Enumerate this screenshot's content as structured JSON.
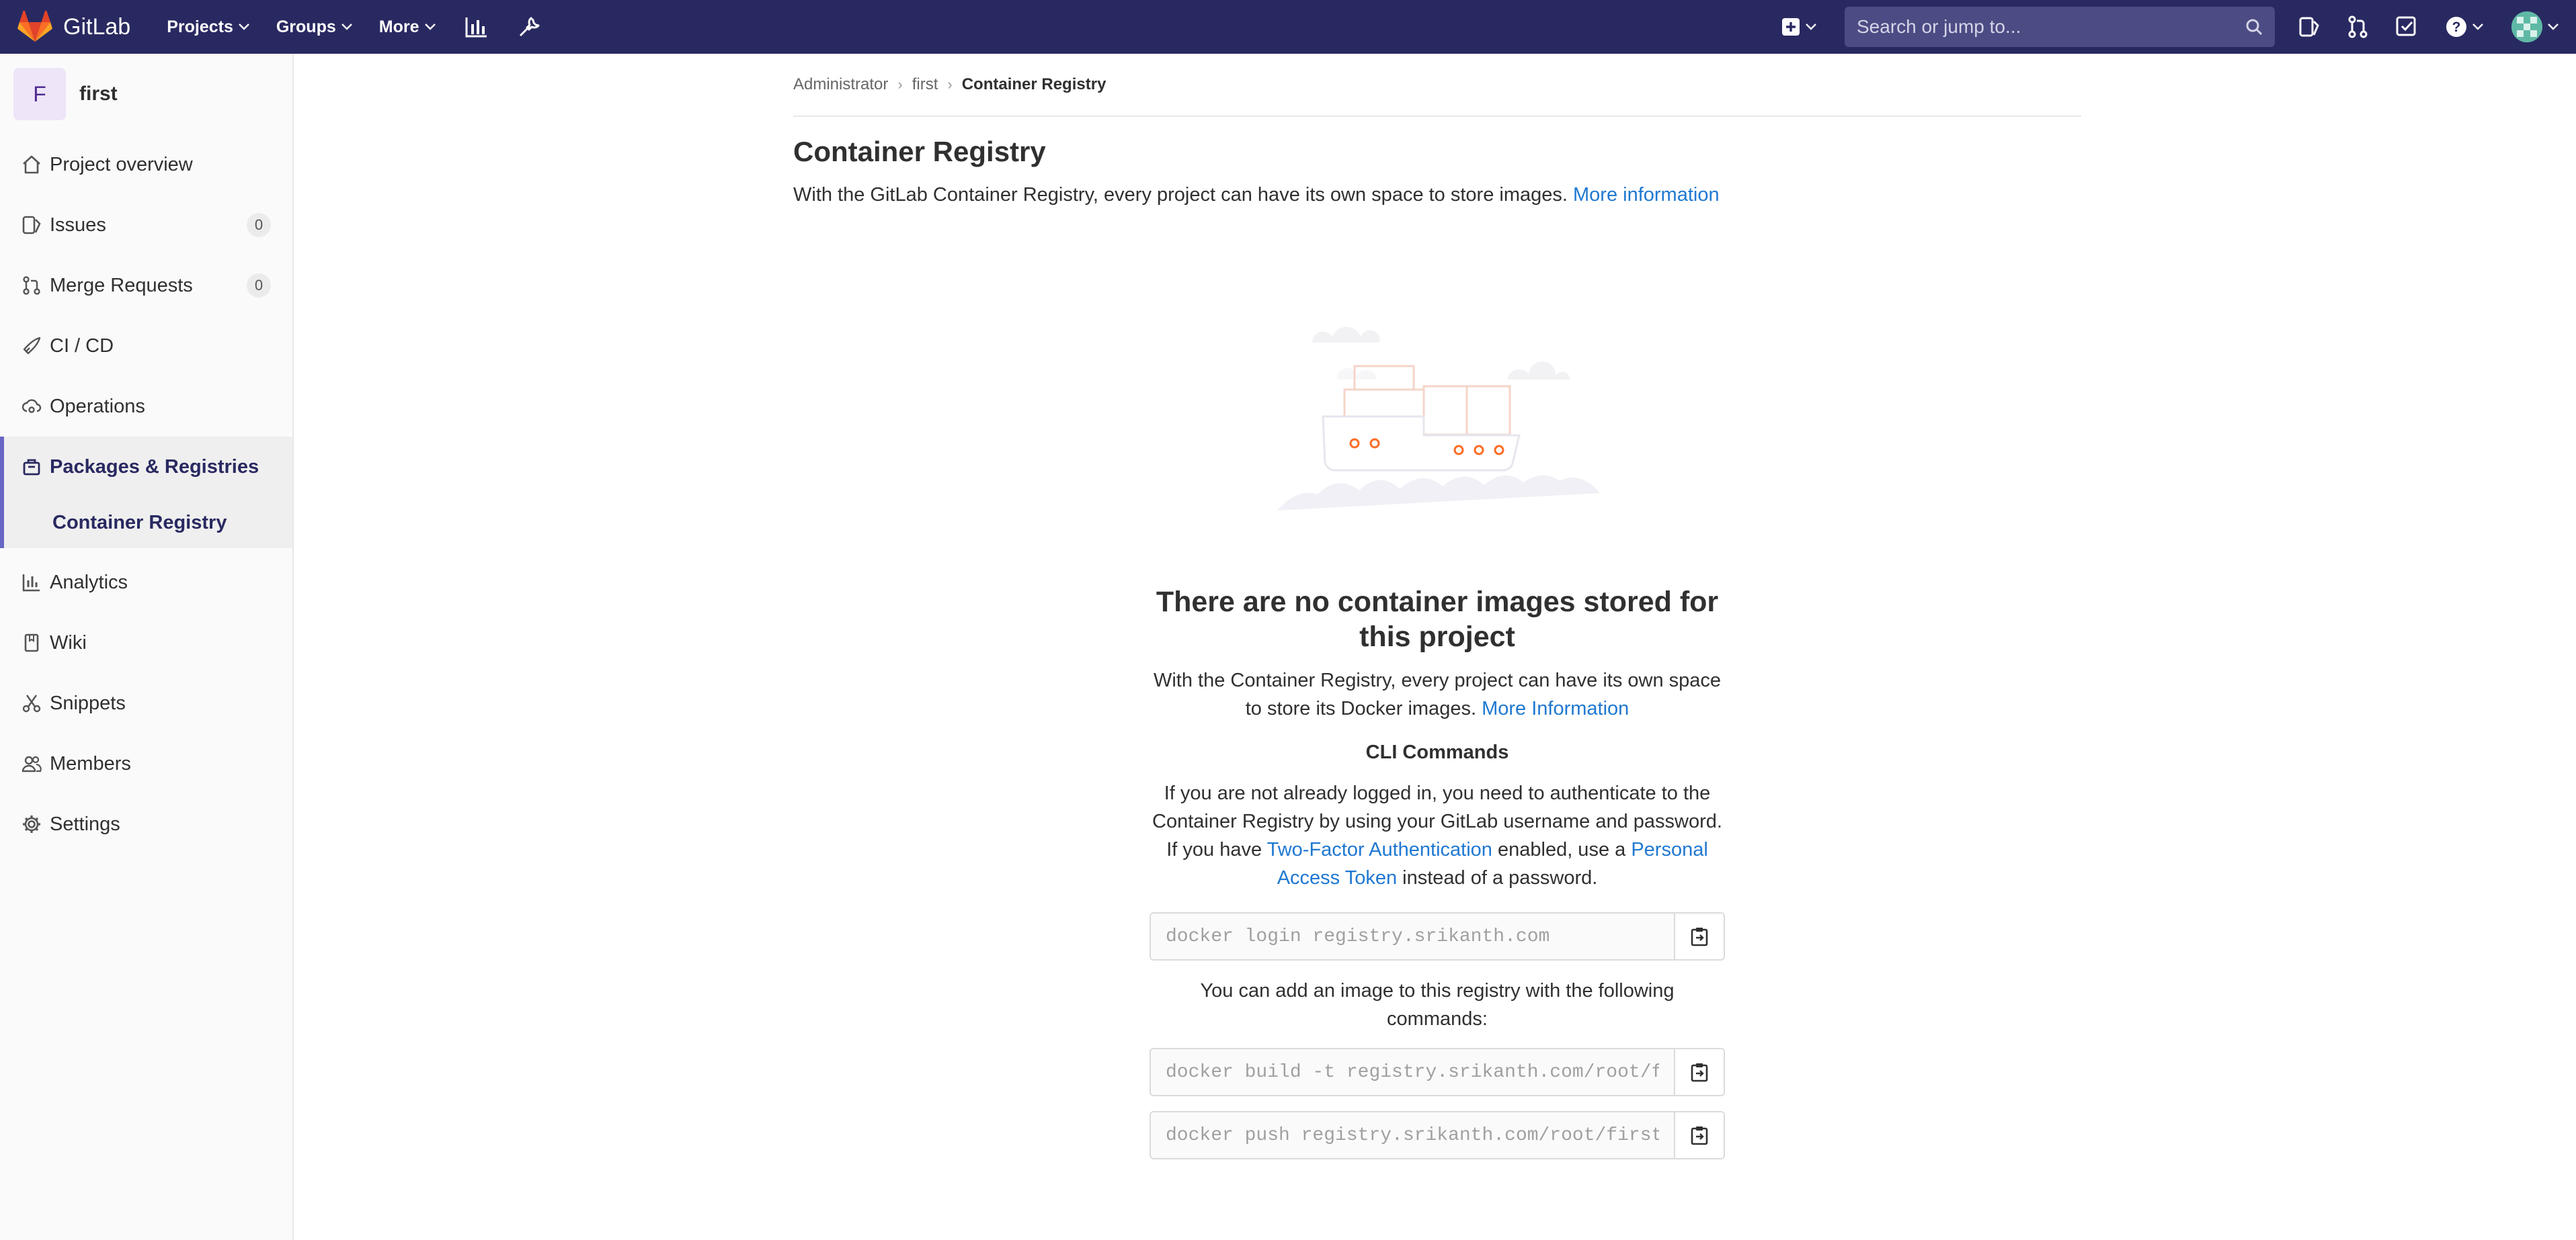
{
  "navbar": {
    "brand": "GitLab",
    "projects": "Projects",
    "groups": "Groups",
    "more": "More",
    "search_placeholder": "Search or jump to..."
  },
  "sidebar": {
    "project_initial": "F",
    "project_name": "first",
    "items": [
      {
        "label": "Project overview",
        "icon": "home-icon"
      },
      {
        "label": "Issues",
        "icon": "issues-icon",
        "count": "0"
      },
      {
        "label": "Merge Requests",
        "icon": "merge-request-icon",
        "count": "0"
      },
      {
        "label": "CI / CD",
        "icon": "rocket-icon"
      },
      {
        "label": "Operations",
        "icon": "cloud-gear-icon"
      },
      {
        "label": "Packages & Registries",
        "icon": "package-icon"
      },
      {
        "label": "Analytics",
        "icon": "chart-icon"
      },
      {
        "label": "Wiki",
        "icon": "book-icon"
      },
      {
        "label": "Snippets",
        "icon": "scissors-icon"
      },
      {
        "label": "Members",
        "icon": "users-icon"
      },
      {
        "label": "Settings",
        "icon": "gear-icon"
      }
    ],
    "subitem": "Container Registry"
  },
  "breadcrumb": {
    "items": [
      "Administrator",
      "first",
      "Container Registry"
    ]
  },
  "page": {
    "title": "Container Registry",
    "lead": "With the GitLab Container Registry, every project can have its own space to store images.",
    "lead_link": "More information"
  },
  "empty_state": {
    "title": "There are no container images stored for this project",
    "desc": "With the Container Registry, every project can have its own space to store its Docker images.",
    "desc_link": "More Information",
    "cli_heading": "CLI Commands",
    "cli_text_1": "If you are not already logged in, you need to authenticate to the Container Registry by using your GitLab username and password. If you have",
    "cli_link_1": "Two-Factor Authentication",
    "cli_text_2": "enabled, use a",
    "cli_link_2": "Personal Access Token",
    "cli_text_3": "instead of a password.",
    "login_cmd": "docker login registry.srikanth.com",
    "add_text": "You can add an image to this registry with the following commands:",
    "build_cmd": "docker build -t registry.srikanth.com/root/first .",
    "push_cmd": "docker push registry.srikanth.com/root/first"
  },
  "colors": {
    "navbar": "#292961",
    "link": "#1f78d1",
    "accent": "#6666c4"
  }
}
